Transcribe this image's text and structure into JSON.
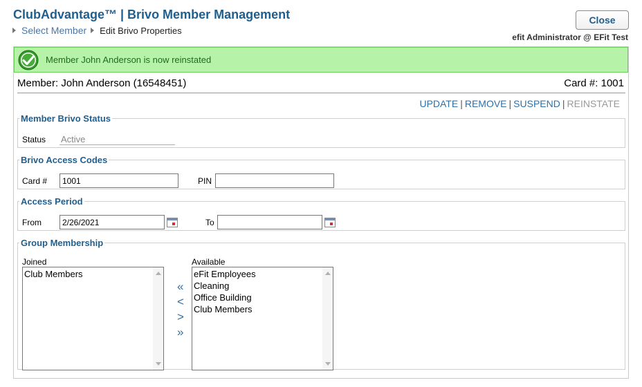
{
  "header": {
    "title": "ClubAdvantage™ | Brivo Member Management",
    "breadcrumb": {
      "link": "Select Member",
      "current": "Edit Brivo Properties"
    },
    "close_label": "Close",
    "user": "efit Administrator @ EFit Test"
  },
  "banner": {
    "message": "Member John Anderson is now reinstated",
    "icon": "checkmark-icon"
  },
  "member": {
    "label": "Member:",
    "value": "John Anderson (16548451)",
    "card_label": "Card #:",
    "card_value": "1001"
  },
  "actions": {
    "update": "UPDATE",
    "remove": "REMOVE",
    "suspend": "SUSPEND",
    "reinstate": "REINSTATE",
    "sep": "|"
  },
  "status_section": {
    "legend": "Member Brivo Status",
    "status_label": "Status",
    "status_value": "Active"
  },
  "access_codes": {
    "legend": "Brivo Access Codes",
    "card_label": "Card #",
    "card_value": "1001",
    "pin_label": "PIN",
    "pin_value": ""
  },
  "access_period": {
    "legend": "Access Period",
    "from_label": "From",
    "from_value": "2/26/2021",
    "to_label": "To",
    "to_value": ""
  },
  "groups": {
    "legend": "Group Membership",
    "joined_label": "Joined",
    "joined": [
      "Club Members"
    ],
    "available_label": "Available",
    "available": [
      "eFit Employees",
      "Cleaning",
      "Office Building",
      "Club Members"
    ],
    "move_all_left": "«",
    "move_left": "<",
    "move_right": ">",
    "move_all_right": "»"
  },
  "colors": {
    "accent": "#1f5f8f",
    "link": "#2f6fa6",
    "success_bg": "#b7f2a9",
    "success_text": "#1f6b1f"
  }
}
